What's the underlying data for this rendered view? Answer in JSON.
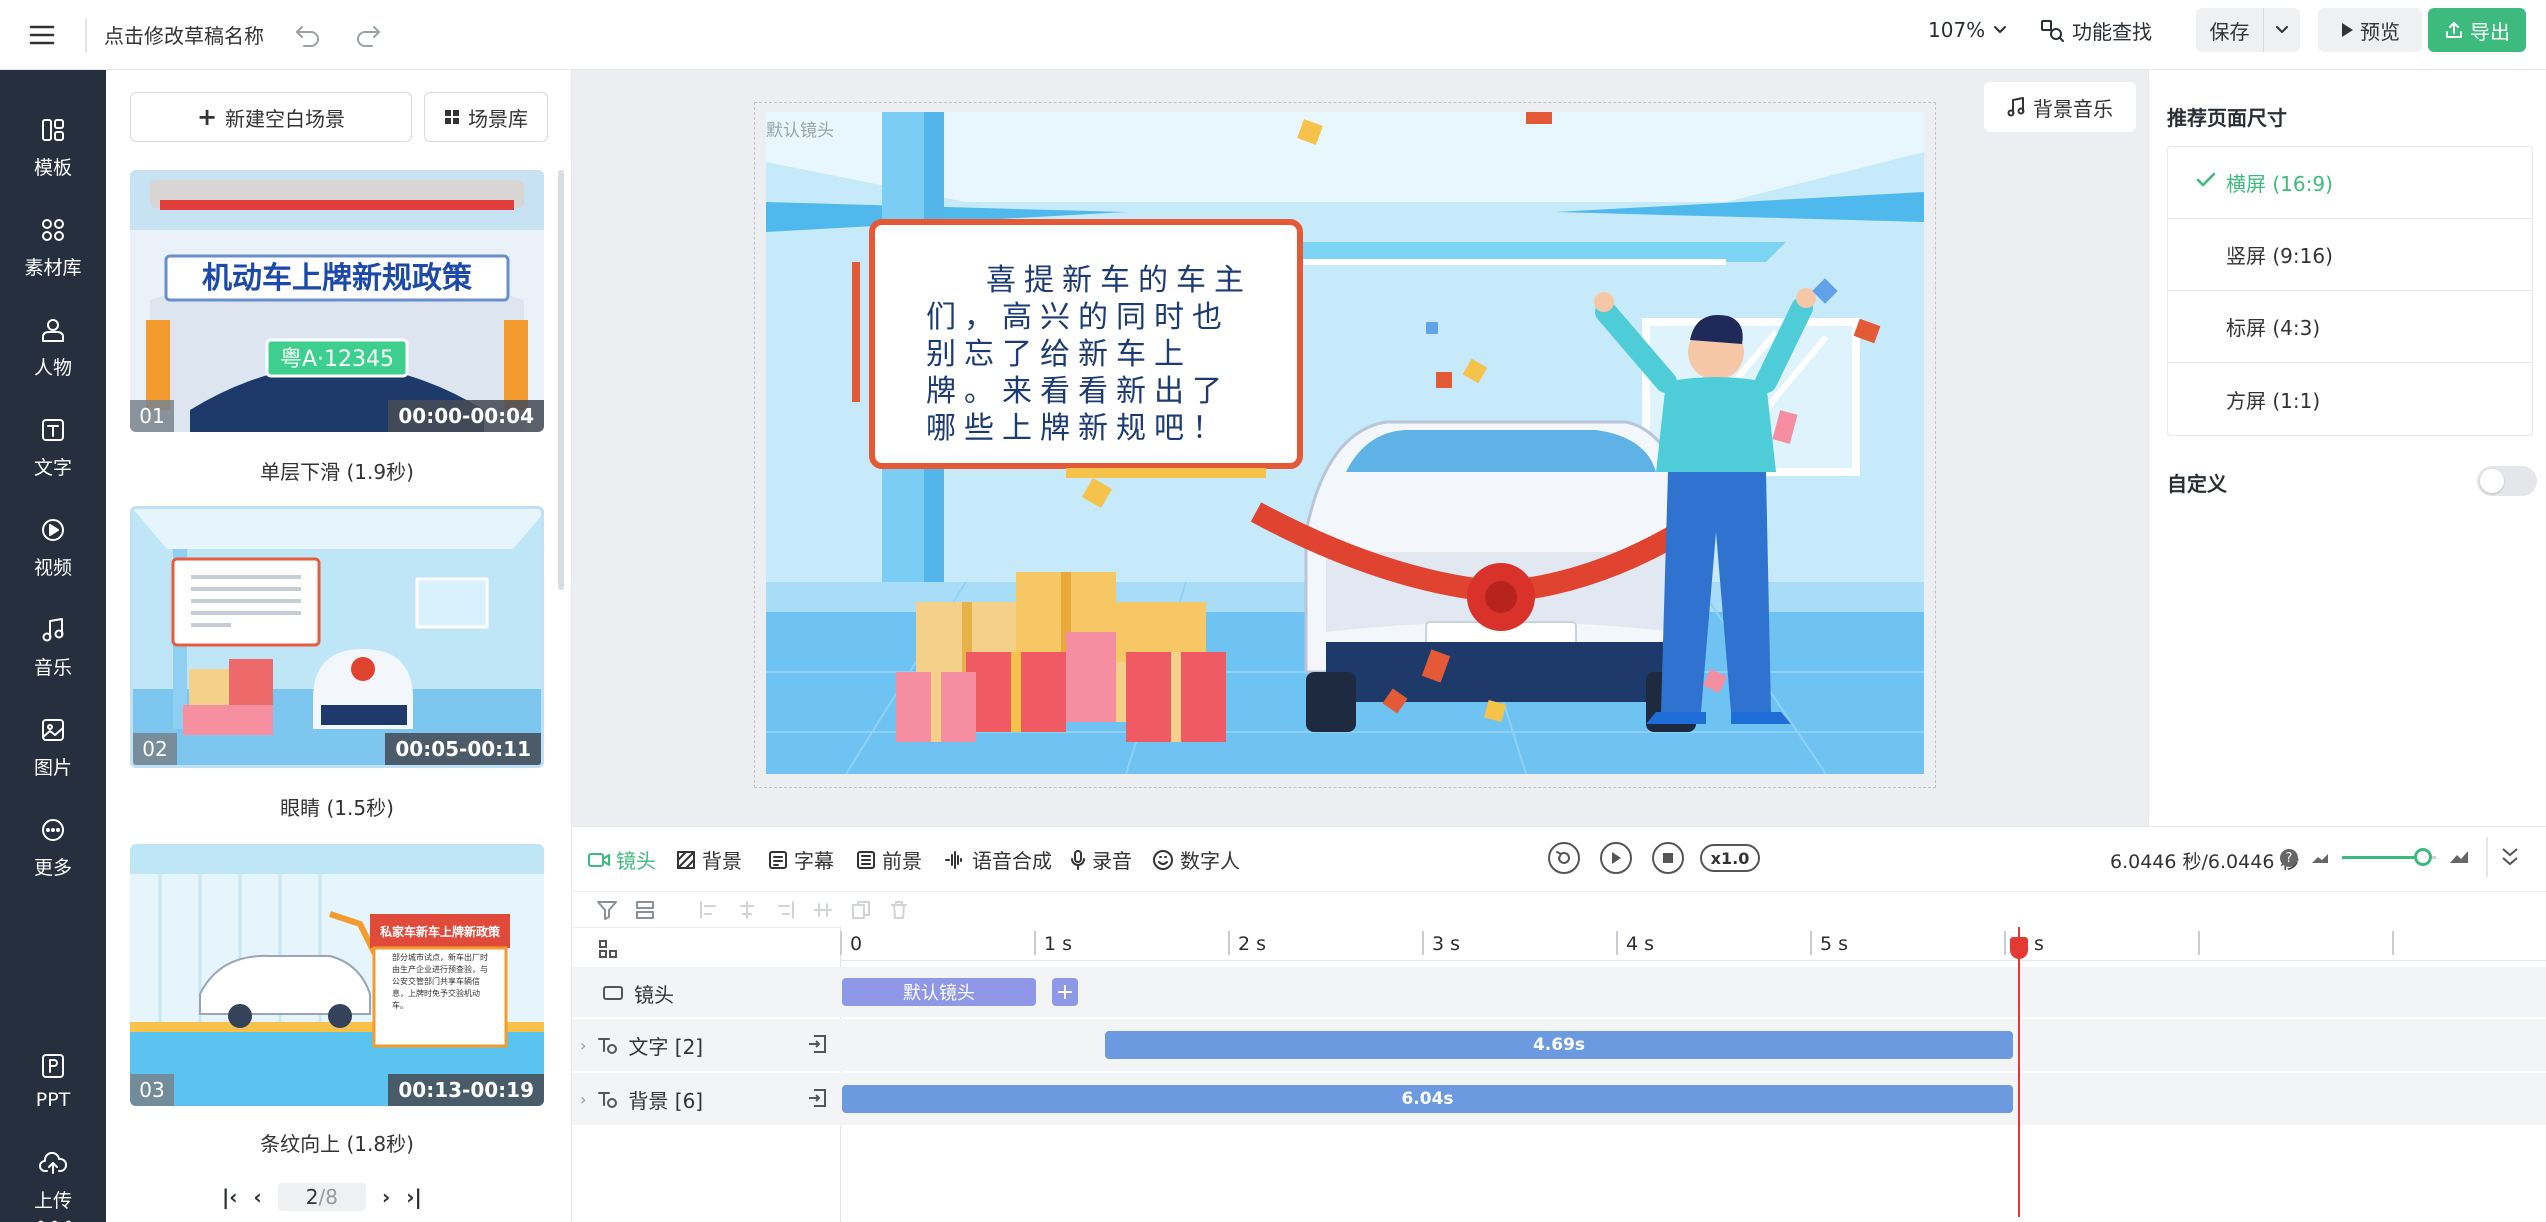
{
  "topbar": {
    "draft_name": "点击修改草稿名称",
    "zoom": "107%",
    "feature_search": "功能查找",
    "save": "保存",
    "preview": "预览",
    "export": "导出"
  },
  "leftnav": {
    "items": [
      {
        "label": "模板",
        "icon": "template-icon"
      },
      {
        "label": "素材库",
        "icon": "library-icon"
      },
      {
        "label": "人物",
        "icon": "person-icon"
      },
      {
        "label": "文字",
        "icon": "text-icon"
      },
      {
        "label": "视频",
        "icon": "video-icon"
      },
      {
        "label": "音乐",
        "icon": "music-icon"
      },
      {
        "label": "图片",
        "icon": "image-icon"
      },
      {
        "label": "更多",
        "icon": "more-icon"
      }
    ],
    "bottom": [
      {
        "label": "PPT",
        "icon": "ppt-icon"
      },
      {
        "label": "上传",
        "icon": "upload-icon"
      }
    ]
  },
  "scenes": {
    "new_blank": "新建空白场景",
    "library": "场景库",
    "items": [
      {
        "num": "01",
        "time": "00:00-00:04",
        "name": "单层下滑 (1.9秒)",
        "banner": "机动车上牌新规政策",
        "plate": "粤A·12345"
      },
      {
        "num": "02",
        "time": "00:05-00:11",
        "name": "眼睛 (1.5秒)"
      },
      {
        "num": "03",
        "time": "00:13-00:19",
        "name": "条纹向上 (1.8秒)",
        "banner": "私家车新车上牌新政策",
        "bubble": "部分城市试点，新车出厂时由生产企业进行预查验，与公安交管部门共享车辆信息，上牌时免予交验机动车。"
      }
    ],
    "pager": {
      "current": "2",
      "total": "/8"
    }
  },
  "canvas": {
    "bgm_button": "背景音乐",
    "default_shot_label": "默认镜头",
    "speech_text": "喜提新车的车主们，高兴的同时也别忘了给新车上牌。来看看新出了哪些上牌新规吧！"
  },
  "rightpanel": {
    "title": "推荐页面尺寸",
    "sizes": [
      {
        "label": "横屏 (16:9)",
        "selected": true
      },
      {
        "label": "竖屏 (9:16)",
        "selected": false
      },
      {
        "label": "标屏 (4:3)",
        "selected": false
      },
      {
        "label": "方屏 (1:1)",
        "selected": false
      }
    ],
    "custom": "自定义",
    "custom_enabled": false
  },
  "timeline": {
    "tabs": [
      "镜头",
      "背景",
      "字幕",
      "前景",
      "语音合成",
      "录音",
      "数字人"
    ],
    "speed": "x1.0",
    "time_display": "6.0446 秒/6.0446 秒",
    "ruler": [
      "0",
      "1 s",
      "2 s",
      "3 s",
      "4 s",
      "5 s",
      "s"
    ],
    "tracks": [
      {
        "label": "镜头",
        "clip": "默认镜头"
      },
      {
        "label": "文字 [2]",
        "clip": "4.69s"
      },
      {
        "label": "背景 [6]",
        "clip": "6.04s"
      }
    ]
  },
  "colors": {
    "accent_green": "#3dba7e",
    "clip_blue": "#6b9ae0",
    "shot_purple": "#8f98e6",
    "playhead_red": "#e53935",
    "nav_bg": "#262f3d"
  }
}
